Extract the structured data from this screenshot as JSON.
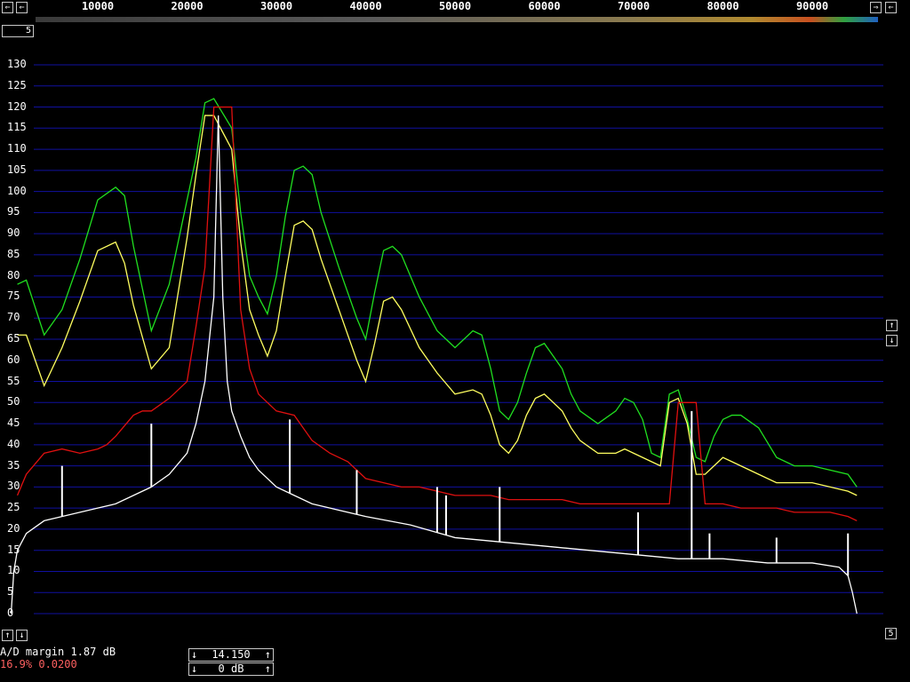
{
  "x_axis": {
    "ticks": [
      "10000",
      "20000",
      "30000",
      "40000",
      "50000",
      "60000",
      "70000",
      "80000",
      "90000"
    ]
  },
  "y_axis": {
    "ticks": [
      "130",
      "125",
      "120",
      "115",
      "110",
      "105",
      "100",
      "95",
      "90",
      "85",
      "80",
      "75",
      "70",
      "65",
      "60",
      "55",
      "50",
      "45",
      "40",
      "35",
      "30",
      "25",
      "20",
      "15",
      "10",
      "5",
      "0"
    ]
  },
  "buttons": {
    "scroll_left": "⇐",
    "scroll_left2": "⇐",
    "scroll_right": "⇒",
    "scroll_right2": "⇐",
    "zoom_label": "5",
    "y_up": "↑",
    "y_down": "↓",
    "bottom_up": "↑",
    "bottom_down": "↓",
    "bottom_right": "5"
  },
  "status": {
    "ad_margin": "A/D margin 1.87 dB",
    "level": "16.9% 0.0200"
  },
  "controls": {
    "gain_value": "14.150",
    "db_value": "0 dB",
    "up": "↑",
    "down": "↓"
  },
  "colors": {
    "grid": "#1010a0",
    "white_trace": "#ffffff",
    "red_trace": "#e01010",
    "yellow_trace": "#ffff60",
    "green_trace": "#20e020"
  },
  "chart_data": {
    "type": "line",
    "x_ticks": [
      10000,
      20000,
      30000,
      40000,
      50000,
      60000,
      70000,
      80000,
      90000
    ],
    "ylim": [
      0,
      130
    ],
    "grid": true,
    "series": [
      {
        "color": "green",
        "x": [
          1000,
          2000,
          4000,
          6000,
          8000,
          10000,
          12000,
          13000,
          14000,
          16000,
          18000,
          20000,
          21000,
          22000,
          23000,
          25000,
          26000,
          27000,
          28000,
          29000,
          30000,
          31000,
          32000,
          33000,
          34000,
          35000,
          37000,
          39000,
          40000,
          41000,
          42000,
          43000,
          44000,
          46000,
          48000,
          50000,
          52000,
          53000,
          54000,
          55000,
          56000,
          57000,
          58000,
          59000,
          60000,
          62000,
          63000,
          64000,
          66000,
          68000,
          69000,
          70000,
          71000,
          72000,
          73000,
          74000,
          75000,
          76000,
          77000,
          78000,
          79000,
          80000,
          81000,
          82000,
          84000,
          86000,
          88000,
          90000,
          92000,
          94000,
          95000
        ],
        "y": [
          78,
          79,
          66,
          72,
          84,
          98,
          101,
          99,
          87,
          67,
          78,
          98,
          108,
          121,
          122,
          115,
          95,
          80,
          75,
          71,
          80,
          94,
          105,
          106,
          104,
          95,
          82,
          70,
          65,
          76,
          86,
          87,
          85,
          75,
          67,
          63,
          67,
          66,
          58,
          48,
          46,
          50,
          57,
          63,
          64,
          58,
          52,
          48,
          45,
          48,
          51,
          50,
          46,
          38,
          37,
          52,
          53,
          46,
          37,
          36,
          42,
          46,
          47,
          47,
          44,
          37,
          35,
          35,
          34,
          33,
          30
        ]
      },
      {
        "color": "yellow",
        "x": [
          1000,
          2000,
          4000,
          6000,
          8000,
          10000,
          12000,
          13000,
          14000,
          16000,
          18000,
          20000,
          21000,
          22000,
          23000,
          25000,
          26000,
          27000,
          28000,
          29000,
          30000,
          31000,
          32000,
          33000,
          34000,
          35000,
          37000,
          39000,
          40000,
          41000,
          42000,
          43000,
          44000,
          46000,
          48000,
          50000,
          52000,
          53000,
          54000,
          55000,
          56000,
          57000,
          58000,
          59000,
          60000,
          62000,
          63000,
          64000,
          66000,
          68000,
          69000,
          70000,
          71000,
          72000,
          73000,
          74000,
          75000,
          76000,
          77000,
          78000,
          79000,
          80000,
          81000,
          82000,
          84000,
          86000,
          88000,
          90000,
          92000,
          94000,
          95000
        ],
        "y": [
          66,
          66,
          54,
          63,
          74,
          86,
          88,
          83,
          73,
          58,
          63,
          89,
          104,
          118,
          118,
          110,
          88,
          72,
          66,
          61,
          67,
          80,
          92,
          93,
          91,
          84,
          72,
          60,
          55,
          64,
          74,
          75,
          72,
          63,
          57,
          52,
          53,
          52,
          47,
          40,
          38,
          41,
          47,
          51,
          52,
          48,
          44,
          41,
          38,
          38,
          39,
          38,
          37,
          36,
          35,
          50,
          51,
          45,
          33,
          33,
          35,
          37,
          36,
          35,
          33,
          31,
          31,
          31,
          30,
          29,
          28
        ]
      },
      {
        "color": "red",
        "x": [
          1000,
          2000,
          4000,
          6000,
          8000,
          10000,
          11000,
          12000,
          14000,
          15000,
          16000,
          18000,
          20000,
          21000,
          22000,
          23000,
          24000,
          25000,
          26000,
          27000,
          28000,
          30000,
          32000,
          34000,
          36000,
          38000,
          40000,
          42000,
          44000,
          46000,
          48000,
          50000,
          52000,
          54000,
          56000,
          58000,
          60000,
          62000,
          64000,
          66000,
          68000,
          70000,
          72000,
          74000,
          75000,
          76000,
          77000,
          78000,
          80000,
          82000,
          84000,
          86000,
          88000,
          90000,
          92000,
          94000,
          95000
        ],
        "y": [
          28,
          33,
          38,
          39,
          38,
          39,
          40,
          42,
          47,
          48,
          48,
          51,
          55,
          68,
          82,
          120,
          120,
          120,
          72,
          58,
          52,
          48,
          47,
          41,
          38,
          36,
          32,
          31,
          30,
          30,
          29,
          28,
          28,
          28,
          27,
          27,
          27,
          27,
          26,
          26,
          26,
          26,
          26,
          26,
          50,
          50,
          50,
          26,
          26,
          25,
          25,
          25,
          24,
          24,
          24,
          23,
          22
        ]
      },
      {
        "color": "white",
        "x": [
          300,
          600,
          1000,
          2000,
          4000,
          6000,
          8000,
          10000,
          12000,
          14000,
          16000,
          18000,
          20000,
          21000,
          22000,
          23000,
          23500,
          24000,
          24500,
          25000,
          26000,
          27000,
          28000,
          30000,
          32000,
          34000,
          36000,
          40000,
          45000,
          50000,
          55000,
          60000,
          65000,
          70000,
          75000,
          80000,
          85000,
          90000,
          93000,
          94000,
          94500,
          95000
        ],
        "y": [
          0,
          10,
          15,
          19,
          22,
          23,
          24,
          25,
          26,
          28,
          30,
          33,
          38,
          45,
          55,
          75,
          118,
          75,
          55,
          48,
          42,
          37,
          34,
          30,
          28,
          26,
          25,
          23,
          21,
          18,
          17,
          16,
          15,
          14,
          13,
          13,
          12,
          12,
          11,
          9,
          5,
          0
        ]
      },
      {
        "color": "white-spikes",
        "x": [
          6000,
          16000,
          31500,
          39000,
          48000,
          49000,
          55000,
          70500,
          76500,
          78500,
          86000,
          94000
        ],
        "y": [
          35,
          45,
          46,
          34,
          30,
          28,
          30,
          24,
          48,
          19,
          18,
          19
        ]
      }
    ]
  }
}
